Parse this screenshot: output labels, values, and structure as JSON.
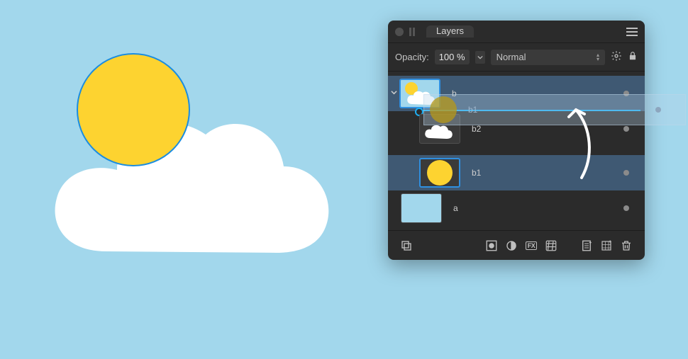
{
  "panel": {
    "tab_label": "Layers",
    "opacity_label": "Opacity:",
    "opacity_value": "100 %",
    "blend_mode": "Normal"
  },
  "layers": {
    "group": {
      "name": "b"
    },
    "child_cloud": {
      "name": "b2"
    },
    "child_sun": {
      "name": "b1"
    },
    "bg": {
      "name": "a"
    }
  },
  "drag": {
    "ghost_label": "b1"
  },
  "icons": {
    "gear": "gear-icon",
    "lock": "lock-icon",
    "menu": "menu-icon",
    "chevron_down": "chevron-down-icon"
  }
}
